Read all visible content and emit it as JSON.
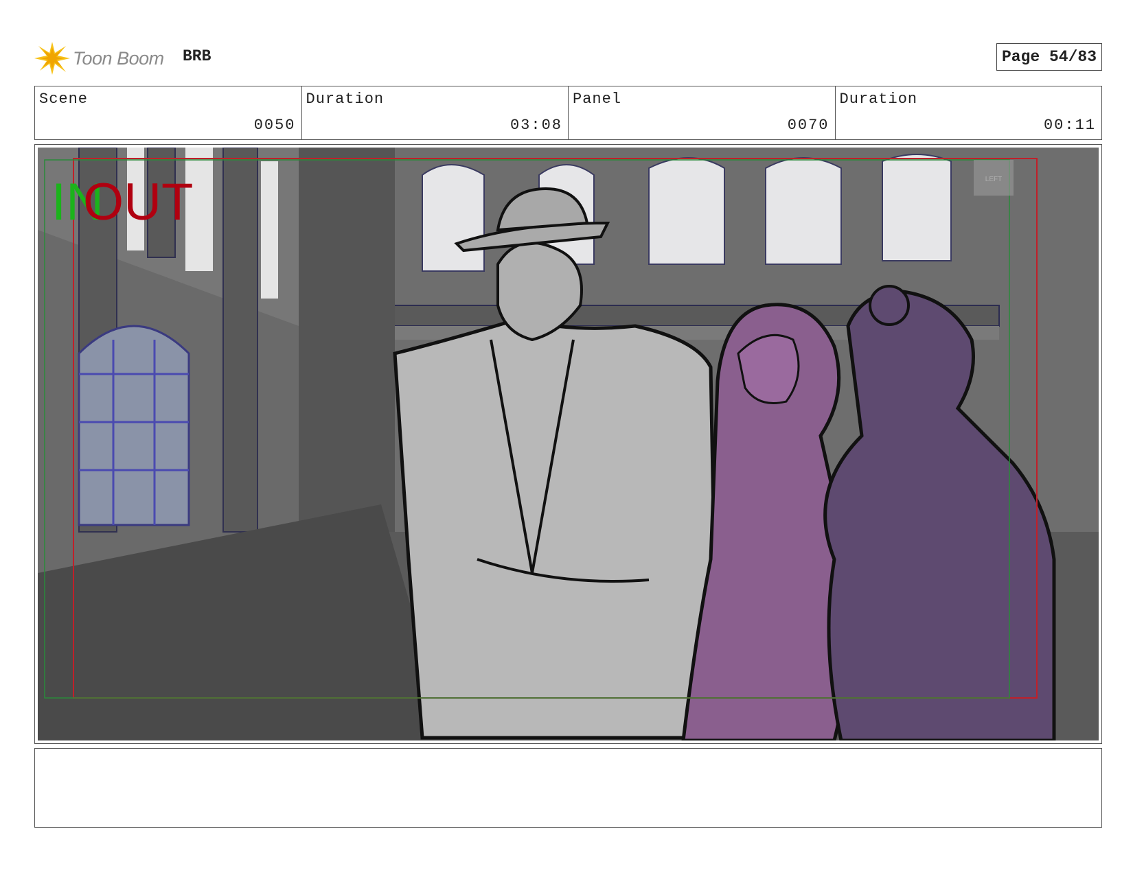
{
  "header": {
    "logo_text": "Toon Boom",
    "project": "BRB",
    "page": "Page 54/83"
  },
  "info": {
    "scene_label": "Scene",
    "scene_value": "0050",
    "scene_duration_label": "Duration",
    "scene_duration_value": "03:08",
    "panel_label": "Panel",
    "panel_value": "0070",
    "panel_duration_label": "Duration",
    "panel_duration_value": "00:11"
  },
  "panel_art": {
    "in_marker": "IN",
    "out_marker": "OUT",
    "wall_sign": "LEFT",
    "colors": {
      "in": "#1bb31b",
      "out": "#b00010",
      "safe_frame": "#c0202a",
      "title_safe": "#2a8a3a",
      "figure_purple": "#8a5f8e",
      "figure_purple_dark": "#5e4a70"
    }
  },
  "notes": ""
}
